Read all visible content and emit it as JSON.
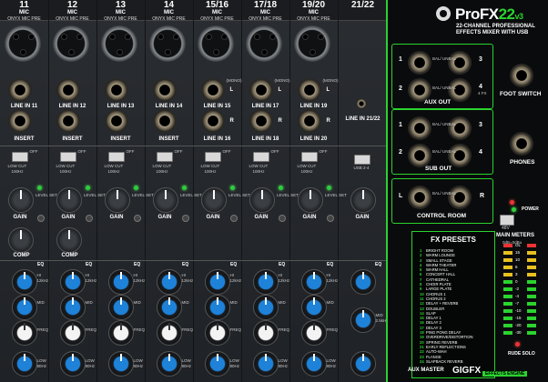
{
  "channels": [
    {
      "num": "11",
      "mic": "MIC",
      "sub": "ONYX MIC PRE",
      "line": "LINE IN 11"
    },
    {
      "num": "12",
      "mic": "MIC",
      "sub": "ONYX MIC PRE",
      "line": "LINE IN 12"
    },
    {
      "num": "13",
      "mic": "MIC",
      "sub": "ONYX MIC PRE",
      "line": "LINE IN 13"
    },
    {
      "num": "14",
      "mic": "MIC",
      "sub": "ONYX MIC PRE",
      "line": "LINE IN 14"
    },
    {
      "num": "15/16",
      "mic": "MIC",
      "sub": "ONYX MIC PRE",
      "line": "LINE IN 15"
    },
    {
      "num": "17/18",
      "mic": "MIC",
      "sub": "ONYX MIC PRE",
      "line": "LINE IN 17"
    },
    {
      "num": "19/20",
      "mic": "MIC",
      "sub": "ONYX MIC PRE",
      "line": "LINE IN 19"
    }
  ],
  "ch21": {
    "num": "21/22",
    "line": "LINE IN 21/22",
    "btn": "USB 2-4"
  },
  "stereo_lines": [
    "LINE IN 16",
    "LINE IN 18",
    "LINE IN 20"
  ],
  "labels": {
    "insert": "INSERT",
    "lowcut": "LOW CUT",
    "lowcut_hz": "100Hz",
    "off": "OFF",
    "level_set": "LEVEL SET",
    "gain": "GAIN",
    "comp": "COMP",
    "off_comp": "OFF",
    "max": "MAX",
    "eq": "EQ",
    "hi": "HI",
    "hi_hz": "12kHz",
    "mid": "MID",
    "freq": "FREQ",
    "low": "LOW",
    "low_hz": "80Hz",
    "bal": "BAL/\nUNBAL",
    "mono": "(MONO)",
    "l": "L",
    "r": "R",
    "mid_hz": "2.5kHz"
  },
  "brand": {
    "name": "ProFX",
    "model": "22",
    "version": "v3",
    "tagline1": "22-CHANNEL PROFESSIONAL",
    "tagline2": "EFFECTS MIXER WITH USB"
  },
  "panel": {
    "aux_out": "AUX OUT",
    "sub_out": "SUB OUT",
    "control_room": "CONTROL ROOM",
    "foot_switch": "FOOT SWITCH",
    "phones": "PHONES",
    "power": "POWER",
    "phantom": "48V",
    "main_meters": "MAIN METERS",
    "meter_range": "0dB=0dBu",
    "rude_solo": "RUDE SOLO",
    "aux_master": "AUX MASTER",
    "gigfx": "GIGFX",
    "effects_engine": "EFFECTS ENGINE",
    "bal_unbal": "BAL/ UNBAL",
    "fx_jack": "4 FX"
  },
  "fx_presets": {
    "title": "FX PRESETS",
    "items": [
      "BRIGHT ROOM",
      "WARM LOUNGE",
      "SMALL STAGE",
      "WARM THEATER",
      "WARM HALL",
      "CONCERT HALL",
      "CATHEDRAL",
      "CHOIR PLATE",
      "LARGE PLATE",
      "CHORUS 1",
      "CHORUS 2",
      "DELAY + REVERB",
      "DOUBLER",
      "SLAP",
      "DELAY 1",
      "DELAY 2",
      "DELAY 3",
      "PING PONG DELAY",
      "OVERDRIVE/DISTORTION",
      "SPRING REVERB",
      "EARLY REFLECTIONS",
      "AUTO-WAH",
      "FLANGE",
      "SLAPBACK REVERB"
    ]
  },
  "meter_scale": [
    "OL",
    "15",
    "10",
    "6",
    "3",
    "0",
    "-2",
    "-4",
    "-7",
    "-10",
    "-15",
    "-20",
    "-30"
  ],
  "colors": {
    "accent": "#2bd32f",
    "eq_blue": "#1e82d8",
    "knob_white": "#f3f3f3"
  }
}
